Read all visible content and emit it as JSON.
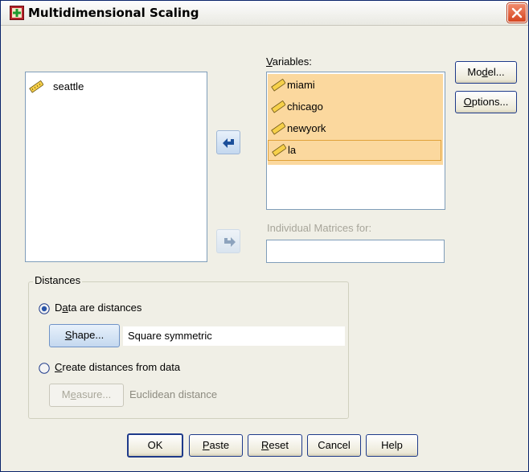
{
  "window": {
    "title": "Multidimensional Scaling"
  },
  "source_list": {
    "items": [
      {
        "label": "seattle",
        "icon": "ruler-scale-icon"
      }
    ]
  },
  "variables": {
    "label_pre": "",
    "label_u": "V",
    "label_post": "ariables:",
    "items": [
      {
        "label": "miami",
        "icon": "ruler-scale-icon"
      },
      {
        "label": "chicago",
        "icon": "ruler-scale-icon"
      },
      {
        "label": "newyork",
        "icon": "ruler-scale-icon"
      },
      {
        "label": "la",
        "icon": "ruler-scale-icon"
      }
    ]
  },
  "individual_matrices": {
    "label": "Individual Matrices for:",
    "value": ""
  },
  "side_buttons": {
    "model_pre": "Mo",
    "model_u": "d",
    "model_post": "el...",
    "options_pre": "",
    "options_u": "O",
    "options_post": "ptions..."
  },
  "distances": {
    "group_title": "Distances",
    "data_are_distances": {
      "pre": "D",
      "u": "a",
      "post": "ta are distances",
      "selected": true
    },
    "shape_button": {
      "pre": "",
      "u": "S",
      "post": "hape..."
    },
    "shape_value": "Square symmetric",
    "create_from_data": {
      "pre": "",
      "u": "C",
      "post": "reate distances from data",
      "selected": false
    },
    "measure_button": {
      "pre": "M",
      "u": "e",
      "post": "asure..."
    },
    "measure_value": "Euclidean distance"
  },
  "footer": {
    "ok": "OK",
    "paste_pre": "",
    "paste_u": "P",
    "paste_post": "aste",
    "reset_pre": "",
    "reset_u": "R",
    "reset_post": "eset",
    "cancel": "Cancel",
    "help": "Help"
  },
  "colors": {
    "selection": "#fbd89e",
    "selection_border": "#e0a23a",
    "window_bg": "#f0efe6",
    "button_border": "#1e3a8a"
  }
}
